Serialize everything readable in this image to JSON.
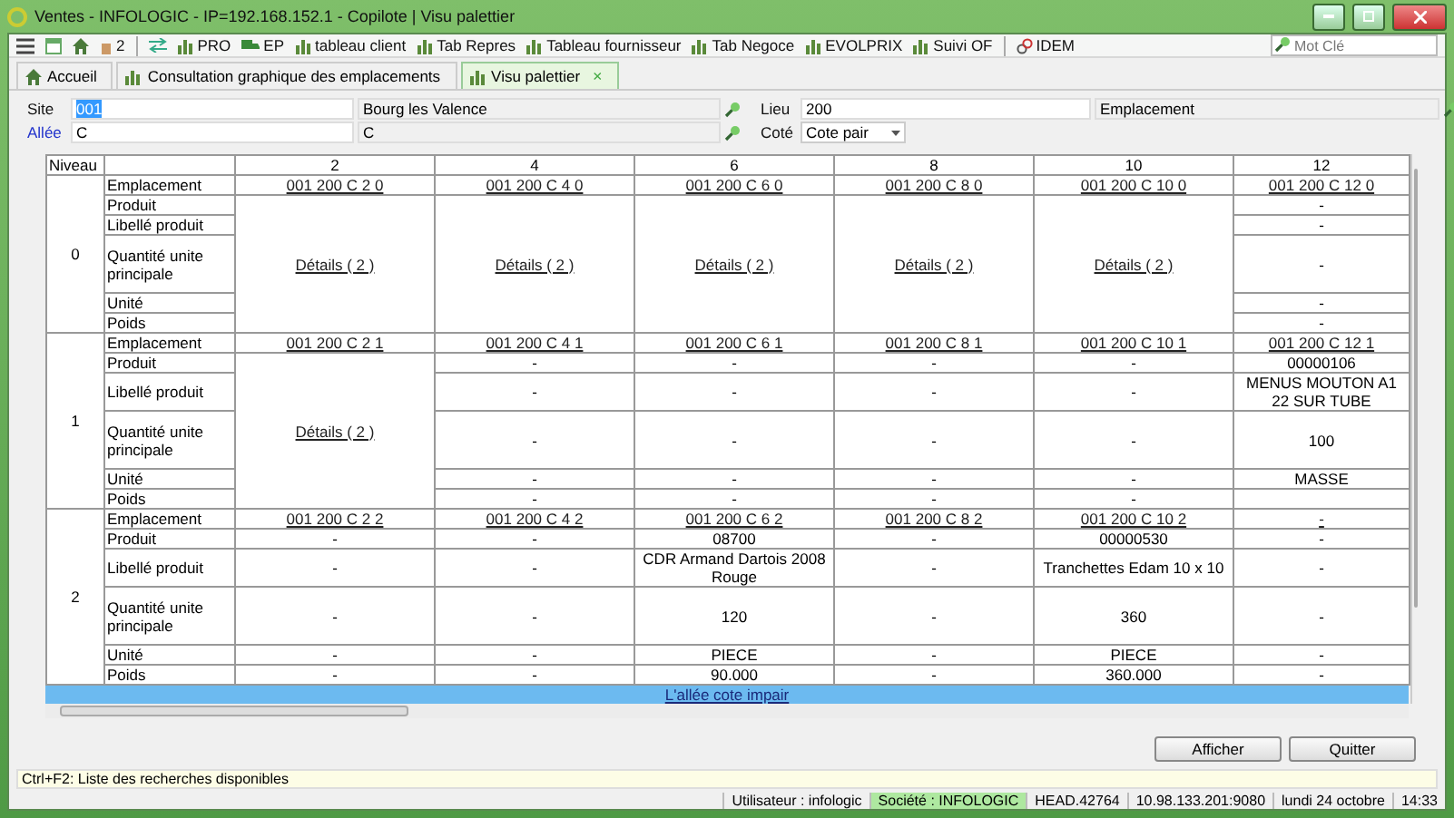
{
  "window": {
    "title": "Ventes - INFOLOGIC - IP=192.168.152.1 - Copilote | Visu palettier"
  },
  "toolbar": {
    "badge": "2",
    "items": [
      {
        "kind": "chart",
        "label": "PRO"
      },
      {
        "kind": "truck",
        "label": "EP"
      },
      {
        "kind": "chart",
        "label": "tableau client"
      },
      {
        "kind": "chart",
        "label": "Tab Repres"
      },
      {
        "kind": "chart",
        "label": "Tableau fournisseur"
      },
      {
        "kind": "chart",
        "label": "Tab Negoce"
      },
      {
        "kind": "chart",
        "label": "EVOLPRIX"
      },
      {
        "kind": "chart",
        "label": "Suivi OF"
      },
      {
        "kind": "link",
        "label": "IDEM"
      }
    ],
    "search": {
      "placeholder": "Mot Clé"
    }
  },
  "tabs": [
    {
      "label": "Accueil",
      "kind": "home",
      "selected": false
    },
    {
      "label": "Consultation graphique des emplacements",
      "kind": "chart",
      "selected": false
    },
    {
      "label": "Visu palettier",
      "kind": "chart",
      "selected": true,
      "close": "×"
    }
  ],
  "form": {
    "site": {
      "label": "Site",
      "value": "001",
      "description": "Bourg les Valence"
    },
    "lieu": {
      "label": "Lieu",
      "value": "200",
      "description": "Emplacement"
    },
    "allee": {
      "label": "Allée",
      "value": "C",
      "description": "C"
    },
    "cote": {
      "label": "Coté",
      "value": "Cote pair"
    }
  },
  "grid": {
    "corner": "Niveau",
    "columns": [
      "2",
      "4",
      "6",
      "8",
      "10",
      "12"
    ],
    "levels": [
      {
        "niveau": "0",
        "labels": [
          "Emplacement",
          "Produit",
          "Libellé produit",
          "Quantité unite principale",
          "Unité",
          "Poids"
        ],
        "cells": [
          {
            "emplacement": "001 200 C 2 0",
            "kind": "details",
            "text": "Détails ( 2 )"
          },
          {
            "emplacement": "001 200 C 4 0",
            "kind": "details",
            "text": "Détails ( 2 )"
          },
          {
            "emplacement": "001 200 C 6 0",
            "kind": "details",
            "text": "Détails ( 2 )"
          },
          {
            "emplacement": "001 200 C 8 0",
            "kind": "details",
            "text": "Détails ( 2 )"
          },
          {
            "emplacement": "001 200 C 10 0",
            "kind": "details",
            "text": "Détails ( 2 )"
          },
          {
            "emplacement": "001 200 C 12 0",
            "kind": "values",
            "values": [
              "-",
              "-",
              "-",
              "-",
              "-"
            ]
          }
        ]
      },
      {
        "niveau": "1",
        "labels": [
          "Emplacement",
          "Produit",
          "Libellé produit",
          "Quantité unite principale",
          "Unité",
          "Poids"
        ],
        "cells": [
          {
            "emplacement": "001 200 C 2 1",
            "kind": "details",
            "text": "Détails ( 2 )"
          },
          {
            "emplacement": "001 200 C 4 1",
            "kind": "values",
            "values": [
              "-",
              "-",
              "-",
              "-",
              "-"
            ]
          },
          {
            "emplacement": "001 200 C 6 1",
            "kind": "values",
            "values": [
              "-",
              "-",
              "-",
              "-",
              "-"
            ]
          },
          {
            "emplacement": "001 200 C 8 1",
            "kind": "values",
            "values": [
              "-",
              "-",
              "-",
              "-",
              "-"
            ]
          },
          {
            "emplacement": "001 200 C 10 1",
            "kind": "values",
            "values": [
              "-",
              "-",
              "-",
              "-",
              "-"
            ]
          },
          {
            "emplacement": "001 200 C 12 1",
            "kind": "values",
            "values": [
              "00000106",
              "MENUS MOUTON A1 22 SUR TUBE",
              "100",
              "MASSE"
            ]
          }
        ]
      },
      {
        "niveau": "2",
        "labels": [
          "Emplacement",
          "Produit",
          "Libellé produit",
          "Quantité unite principale",
          "Unité",
          "Poids"
        ],
        "cells": [
          {
            "emplacement": "001 200 C 2 2",
            "kind": "values",
            "values": [
              "-",
              "-",
              "-",
              "-",
              "-"
            ]
          },
          {
            "emplacement": "001 200 C 4 2",
            "kind": "values",
            "values": [
              "-",
              "-",
              "-",
              "-",
              "-"
            ]
          },
          {
            "emplacement": "001 200 C 6 2",
            "kind": "values",
            "values": [
              "08700",
              "CDR Armand Dartois 2008 Rouge",
              "120",
              "PIECE",
              "90.000"
            ]
          },
          {
            "emplacement": "001 200 C 8 2",
            "kind": "values",
            "values": [
              "-",
              "-",
              "-",
              "-",
              "-"
            ]
          },
          {
            "emplacement": "001 200 C 10 2",
            "kind": "values",
            "values": [
              "00000530",
              "Tranchettes Edam 10 x 10",
              "360",
              "PIECE",
              "360.000"
            ]
          },
          {
            "emplacement": "-",
            "kind": "values",
            "values": [
              "-",
              "-",
              "-",
              "-",
              "-"
            ]
          }
        ]
      }
    ],
    "footer_link": "L'allée cote impair"
  },
  "buttons": [
    "Afficher",
    "Quitter"
  ],
  "hint": "Ctrl+F2: Liste des recherches disponibles",
  "status_bar": [
    {
      "text": "Utilisateur : infologic",
      "highlight": false
    },
    {
      "text": "Société : INFOLOGIC",
      "highlight": true
    },
    {
      "text": "HEAD.42764",
      "highlight": false
    },
    {
      "text": "10.98.133.201:9080",
      "highlight": false
    },
    {
      "text": "lundi 24 octobre",
      "highlight": false
    },
    {
      "text": "14:33",
      "highlight": false
    }
  ]
}
